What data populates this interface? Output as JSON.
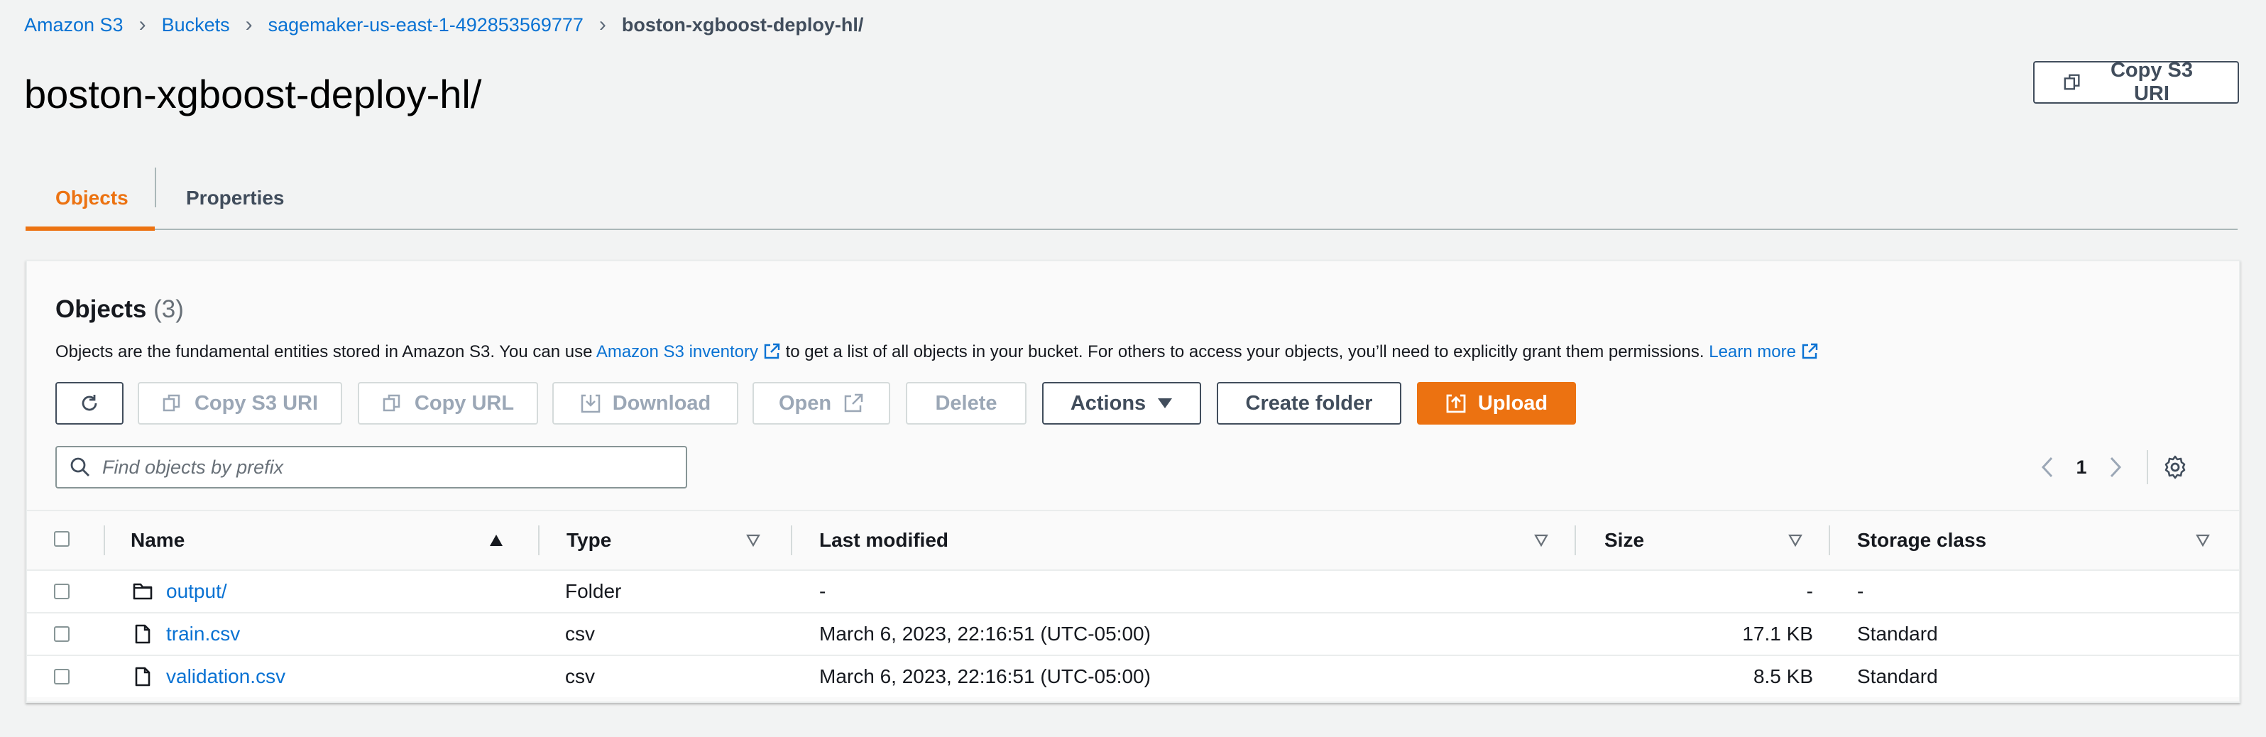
{
  "breadcrumbs": [
    "Amazon S3",
    "Buckets",
    "sagemaker-us-east-1-492853569777",
    "boston-xgboost-deploy-hl/"
  ],
  "page_title": "boston-xgboost-deploy-hl/",
  "copy_s3_uri_top": "Copy S3 URI",
  "tabs": [
    {
      "label": "Objects",
      "active": true
    },
    {
      "label": "Properties",
      "active": false
    }
  ],
  "panel": {
    "title": "Objects",
    "count": "(3)",
    "desc_before": "Objects are the fundamental entities stored in Amazon S3. You can use ",
    "desc_link": "Amazon S3 inventory",
    "desc_middle": " to get a list of all objects in your bucket. For others to access your objects, you’ll need to explicitly grant them permissions.",
    "desc_learn_more": "Learn more"
  },
  "toolbar": {
    "refresh_icon": "refresh-icon",
    "copy_s3_uri": "Copy S3 URI",
    "copy_url": "Copy URL",
    "download": "Download",
    "open": "Open",
    "delete": "Delete",
    "actions": "Actions",
    "create_folder": "Create folder",
    "upload": "Upload"
  },
  "search": {
    "placeholder": "Find objects by prefix",
    "value": ""
  },
  "pagination": {
    "page": "1"
  },
  "table": {
    "columns": [
      "Name",
      "Type",
      "Last modified",
      "Size",
      "Storage class"
    ],
    "rows": [
      {
        "name": "output/",
        "icon": "folder-icon",
        "type": "Folder",
        "modified": "-",
        "size": "-",
        "storage": "-"
      },
      {
        "name": "train.csv",
        "icon": "file-icon",
        "type": "csv",
        "modified": "March 6, 2023, 22:16:51 (UTC-05:00)",
        "size": "17.1 KB",
        "storage": "Standard"
      },
      {
        "name": "validation.csv",
        "icon": "file-icon",
        "type": "csv",
        "modified": "March 6, 2023, 22:16:51 (UTC-05:00)",
        "size": "8.5 KB",
        "storage": "Standard"
      }
    ]
  },
  "colors": {
    "accent": "#ec7211",
    "link": "#0972d3",
    "text": "#16191f",
    "background": "#f2f3f3"
  }
}
